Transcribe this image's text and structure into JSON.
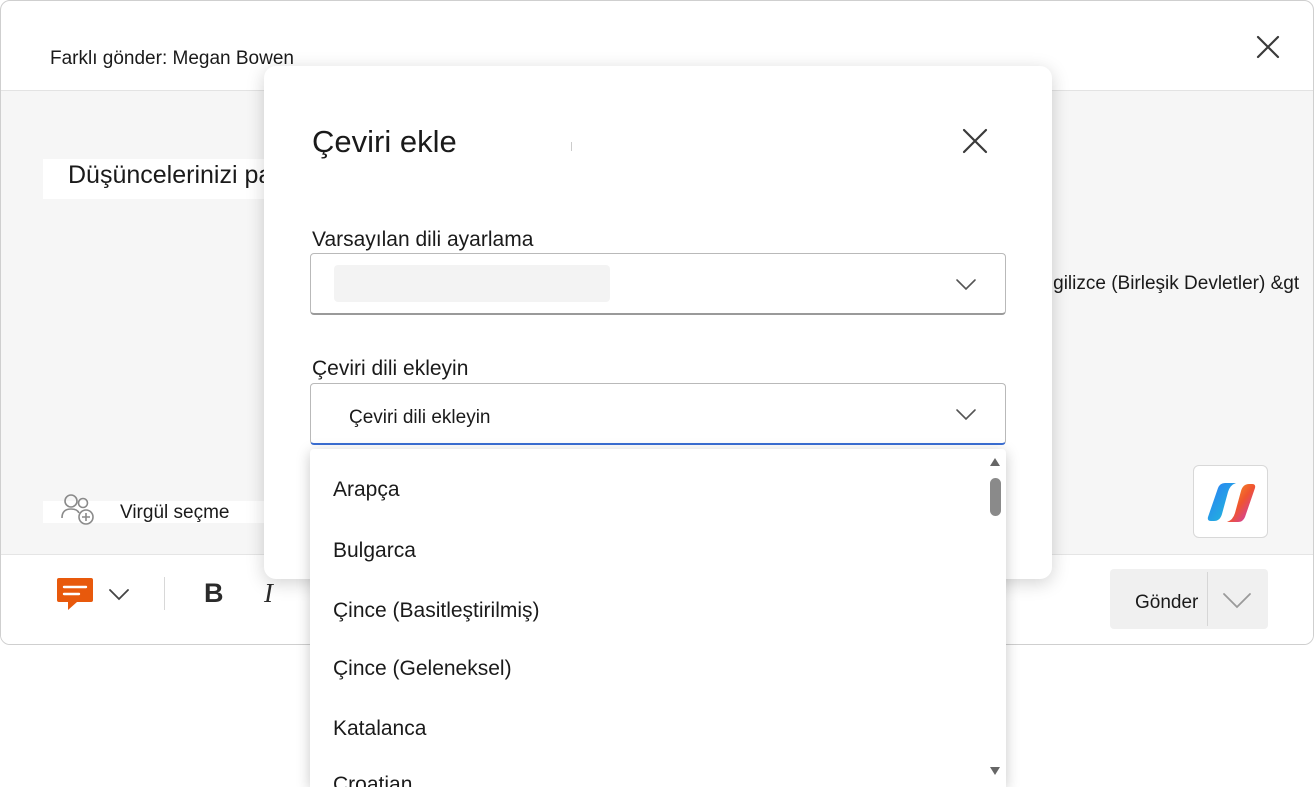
{
  "window": {
    "title": "Farklı gönder: Megan Bowen"
  },
  "compose": {
    "heading": "Düşüncelerinizi paylaşın",
    "recipients_label": "Virgül seçme",
    "side_text": ";İngilizce (Birleşik Devletler) &gt"
  },
  "toolbar": {
    "bold_label": "B",
    "italic_label": "I",
    "send_label": "Gönder"
  },
  "dialog": {
    "title": "Çeviri ekle",
    "default_language_label": "Varsayılan dili ayarlama",
    "default_language_value": "",
    "translation_label": "Çeviri dili ekleyin",
    "translation_placeholder": "Çeviri dili ekleyin",
    "options": [
      "Arapça",
      "Bulgarca",
      "Çince (Basitleştirilmiş)",
      "Çince (Geleneksel)",
      "Katalanca",
      "Croatian"
    ]
  },
  "icons": {
    "close": "close-icon",
    "person_add": "person-add-icon",
    "copilot": "copilot-icon",
    "comment": "comment-icon",
    "chevron": "chevron-down-icon"
  },
  "colors": {
    "accent_focus": "#3b6fd4",
    "comment_icon": "#e8590c",
    "scroll_thumb": "#8a8a8a"
  }
}
